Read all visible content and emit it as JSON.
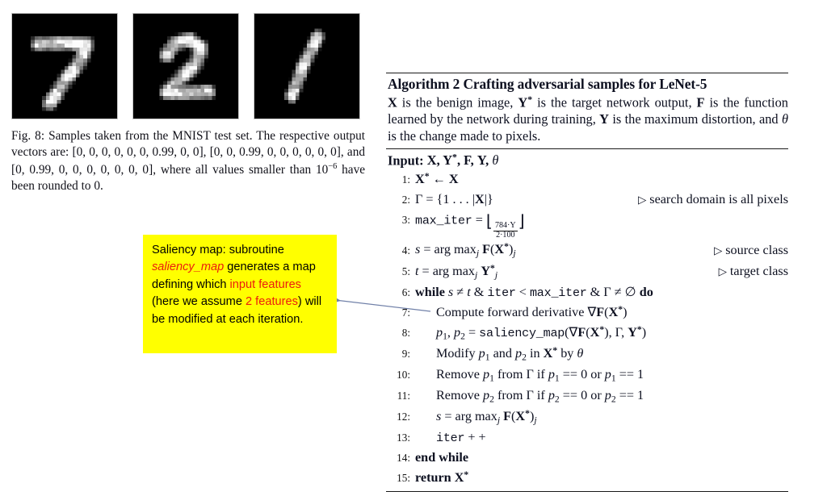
{
  "figure": {
    "samples": [
      {
        "name": "mnist-digit-seven",
        "digit": "7"
      },
      {
        "name": "mnist-digit-two",
        "digit": "2"
      },
      {
        "name": "mnist-digit-one",
        "digit": "1"
      }
    ],
    "caption_label": "Fig. 8:",
    "caption_text": "Samples taken from the MNIST test set. The respective output vectors are:",
    "vectors": [
      "[0, 0, 0, 0, 0, 0, 0.99, 0, 0]",
      "[0, 0, 0.99, 0, 0, 0, 0, 0, 0]",
      "[0, 0.99, 0, 0, 0, 0, 0, 0, 0]"
    ],
    "caption_and": "and",
    "caption_tail_pre": ", where all values smaller than",
    "caption_threshold_base": "10",
    "caption_threshold_exp": "−6",
    "caption_tail_post": "have been rounded to 0."
  },
  "callout": {
    "name": "saliency-map-annotation",
    "background_color": "#FFFF00",
    "highlight_color": "#EC1C0D",
    "segments": [
      {
        "text": "Saliency map: subroutine ",
        "style": "plain"
      },
      {
        "text": "saliency_map",
        "style": "code-italic-red"
      },
      {
        "text": " generates a map defining which ",
        "style": "plain"
      },
      {
        "text": "input features",
        "style": "red"
      },
      {
        "text": " (here we assume ",
        "style": "plain"
      },
      {
        "text": "2 features",
        "style": "red"
      },
      {
        "text": ") will be modified at each iteration.",
        "style": "plain"
      }
    ],
    "full_text": "Saliency map: subroutine saliency_map generates a map defining which input features (here we assume 2 features) will be modified at each iteration."
  },
  "connector": {
    "name": "callout-to-line8-arrow",
    "color": "#7080a8",
    "points_from": "algorithm line 8",
    "points_to": "saliency map callout"
  },
  "algorithm": {
    "title": "Algorithm 2 Crafting adversarial samples for LeNet-5",
    "description": "X is the benign image, Y* is the target network output, F is the function learned by the network during training, Υ is the maximum distortion, and θ is the change made to pixels.",
    "input_label": "Input:",
    "input_args": "X, Y*, F, Υ, θ",
    "lines": [
      {
        "n": "1",
        "indent": 0,
        "text": "X* ← X",
        "comment": ""
      },
      {
        "n": "2",
        "indent": 0,
        "text": "Γ = {1 . . . |X|}",
        "comment": "search domain is all pixels"
      },
      {
        "n": "3",
        "indent": 0,
        "text": "max_iter = ⌊(784·Υ)/(2·100)⌋",
        "comment": ""
      },
      {
        "n": "4",
        "indent": 0,
        "text": "s = arg max_j F(X*)_j",
        "comment": "source class"
      },
      {
        "n": "5",
        "indent": 0,
        "text": "t = arg max_j Y*_j",
        "comment": "target class"
      },
      {
        "n": "6",
        "indent": 0,
        "text": "while s ≠ t & iter < max_iter & Γ ≠ ∅ do",
        "comment": ""
      },
      {
        "n": "7",
        "indent": 1,
        "text": "Compute forward derivative ∇F(X*)",
        "comment": ""
      },
      {
        "n": "8",
        "indent": 1,
        "text": "p₁, p₂ = saliency_map(∇F(X*), Γ, Y*)",
        "comment": ""
      },
      {
        "n": "9",
        "indent": 1,
        "text": "Modify p₁ and p₂ in X* by θ",
        "comment": ""
      },
      {
        "n": "10",
        "indent": 1,
        "text": "Remove p₁ from Γ if p₁ == 0 or p₁ == 1",
        "comment": ""
      },
      {
        "n": "11",
        "indent": 1,
        "text": "Remove p₂ from Γ if p₂ == 0 or p₂ == 1",
        "comment": ""
      },
      {
        "n": "12",
        "indent": 1,
        "text": "s = arg max_j F(X*)_j",
        "comment": ""
      },
      {
        "n": "13",
        "indent": 1,
        "text": "iter + +",
        "comment": ""
      },
      {
        "n": "14",
        "indent": 0,
        "text": "end while",
        "comment": ""
      },
      {
        "n": "15",
        "indent": 0,
        "text": "return X*",
        "comment": ""
      }
    ]
  }
}
